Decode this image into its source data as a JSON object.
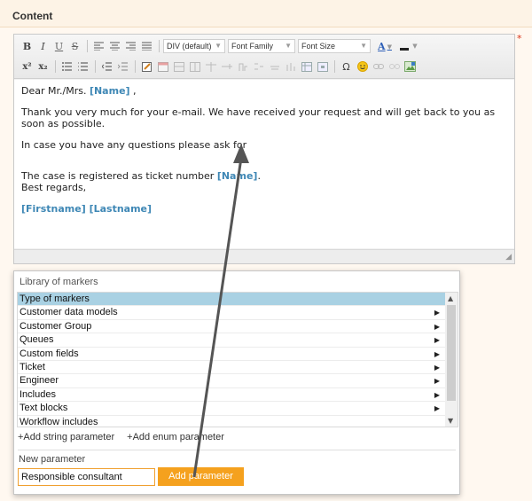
{
  "section": {
    "title": "Content",
    "required_marker": "*"
  },
  "toolbar": {
    "bold": "B",
    "italic": "I",
    "underline": "U",
    "strikethrough": "S",
    "format_select": "DIV (default)",
    "font_family_select": "Font Family",
    "font_size_select": "Font Size",
    "font_color": "A",
    "superscript": "x²",
    "subscript": "x₂",
    "special_char": "Ω"
  },
  "content": {
    "greeting_prefix": "Dear Mr./Mrs. ",
    "greeting_marker": "[Name]",
    "greeting_suffix": " ,",
    "para1": "Thank you very much for your e-mail. We have received your request and will get back to you as soon as possible.",
    "para2": "In case you have any questions please ask for",
    "para3_prefix": "The case is registered as ticket number ",
    "para3_marker": "[Name]",
    "para3_suffix": ".",
    "closing": "Best regards,",
    "signature_marker": "[Firstname] [Lastname]"
  },
  "library": {
    "title": "Library of markers",
    "items": [
      {
        "label": "Type of markers",
        "header": true
      },
      {
        "label": "Customer data models"
      },
      {
        "label": "Customer Group"
      },
      {
        "label": "Queues"
      },
      {
        "label": "Custom fields"
      },
      {
        "label": "Ticket"
      },
      {
        "label": "Engineer"
      },
      {
        "label": "Includes"
      },
      {
        "label": "Text blocks"
      },
      {
        "label": "Workflow includes"
      }
    ],
    "add_string_param": "+Add string parameter",
    "add_enum_param": "+Add enum parameter",
    "new_param_label": "New parameter",
    "new_param_value": "Responsible consultant",
    "add_param_button": "Add parameter"
  },
  "colors": {
    "accent": "#f5a11e",
    "marker_text": "#3e87b5",
    "selected_row": "#a9d1e3",
    "annotation_arrow": "#555555"
  }
}
